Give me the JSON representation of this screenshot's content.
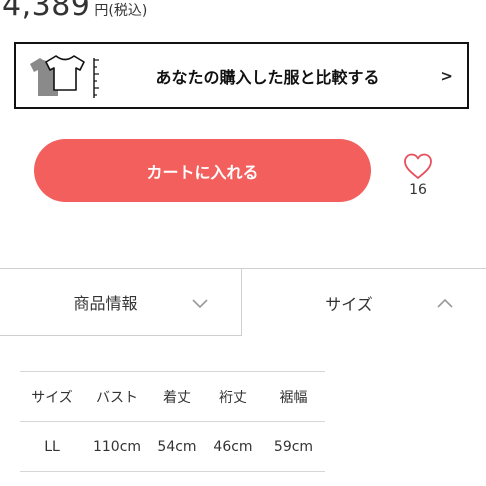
{
  "product": {
    "price": "4,389",
    "price_unit": "円(税込)"
  },
  "compare": {
    "label": "あなたの購入した服と比較する",
    "arrow": ">",
    "icon": "t-shirt-compare-icon"
  },
  "cart": {
    "button_label": "カートに入れる",
    "color": "#f25f5c"
  },
  "favorite": {
    "icon": "heart-outline-icon",
    "count": "16",
    "color": "#e8505b"
  },
  "tabs": [
    {
      "label": "商品情報",
      "icon": "chevron-down-icon",
      "expanded": false
    },
    {
      "label": "サイズ",
      "icon": "chevron-up-icon",
      "expanded": true
    }
  ],
  "size_table": {
    "headers": [
      "サイズ",
      "バスト",
      "着丈",
      "裄丈",
      "裾幅"
    ],
    "rows": [
      [
        "LL",
        "110cm",
        "54cm",
        "46cm",
        "59cm"
      ]
    ]
  }
}
